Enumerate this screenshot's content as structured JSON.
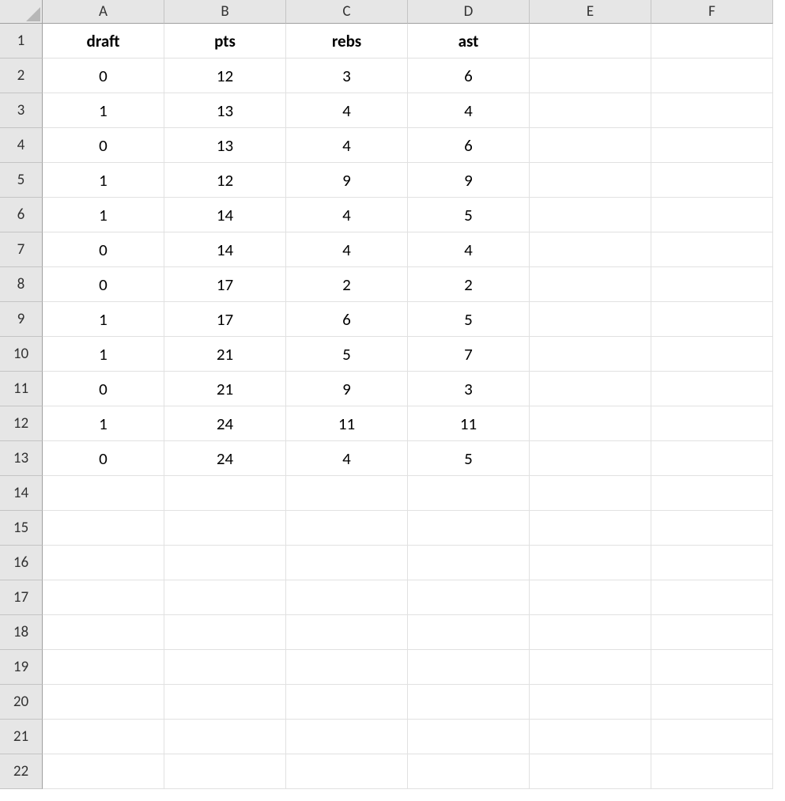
{
  "columns": [
    "A",
    "B",
    "C",
    "D",
    "E",
    "F"
  ],
  "rowCount": 22,
  "dataHeaders": {
    "A": "draft",
    "B": "pts",
    "C": "rebs",
    "D": "ast"
  },
  "dataRows": [
    {
      "A": "0",
      "B": "12",
      "C": "3",
      "D": "6"
    },
    {
      "A": "1",
      "B": "13",
      "C": "4",
      "D": "4"
    },
    {
      "A": "0",
      "B": "13",
      "C": "4",
      "D": "6"
    },
    {
      "A": "1",
      "B": "12",
      "C": "9",
      "D": "9"
    },
    {
      "A": "1",
      "B": "14",
      "C": "4",
      "D": "5"
    },
    {
      "A": "0",
      "B": "14",
      "C": "4",
      "D": "4"
    },
    {
      "A": "0",
      "B": "17",
      "C": "2",
      "D": "2"
    },
    {
      "A": "1",
      "B": "17",
      "C": "6",
      "D": "5"
    },
    {
      "A": "1",
      "B": "21",
      "C": "5",
      "D": "7"
    },
    {
      "A": "0",
      "B": "21",
      "C": "9",
      "D": "3"
    },
    {
      "A": "1",
      "B": "24",
      "C": "11",
      "D": "11"
    },
    {
      "A": "0",
      "B": "24",
      "C": "4",
      "D": "5"
    }
  ]
}
